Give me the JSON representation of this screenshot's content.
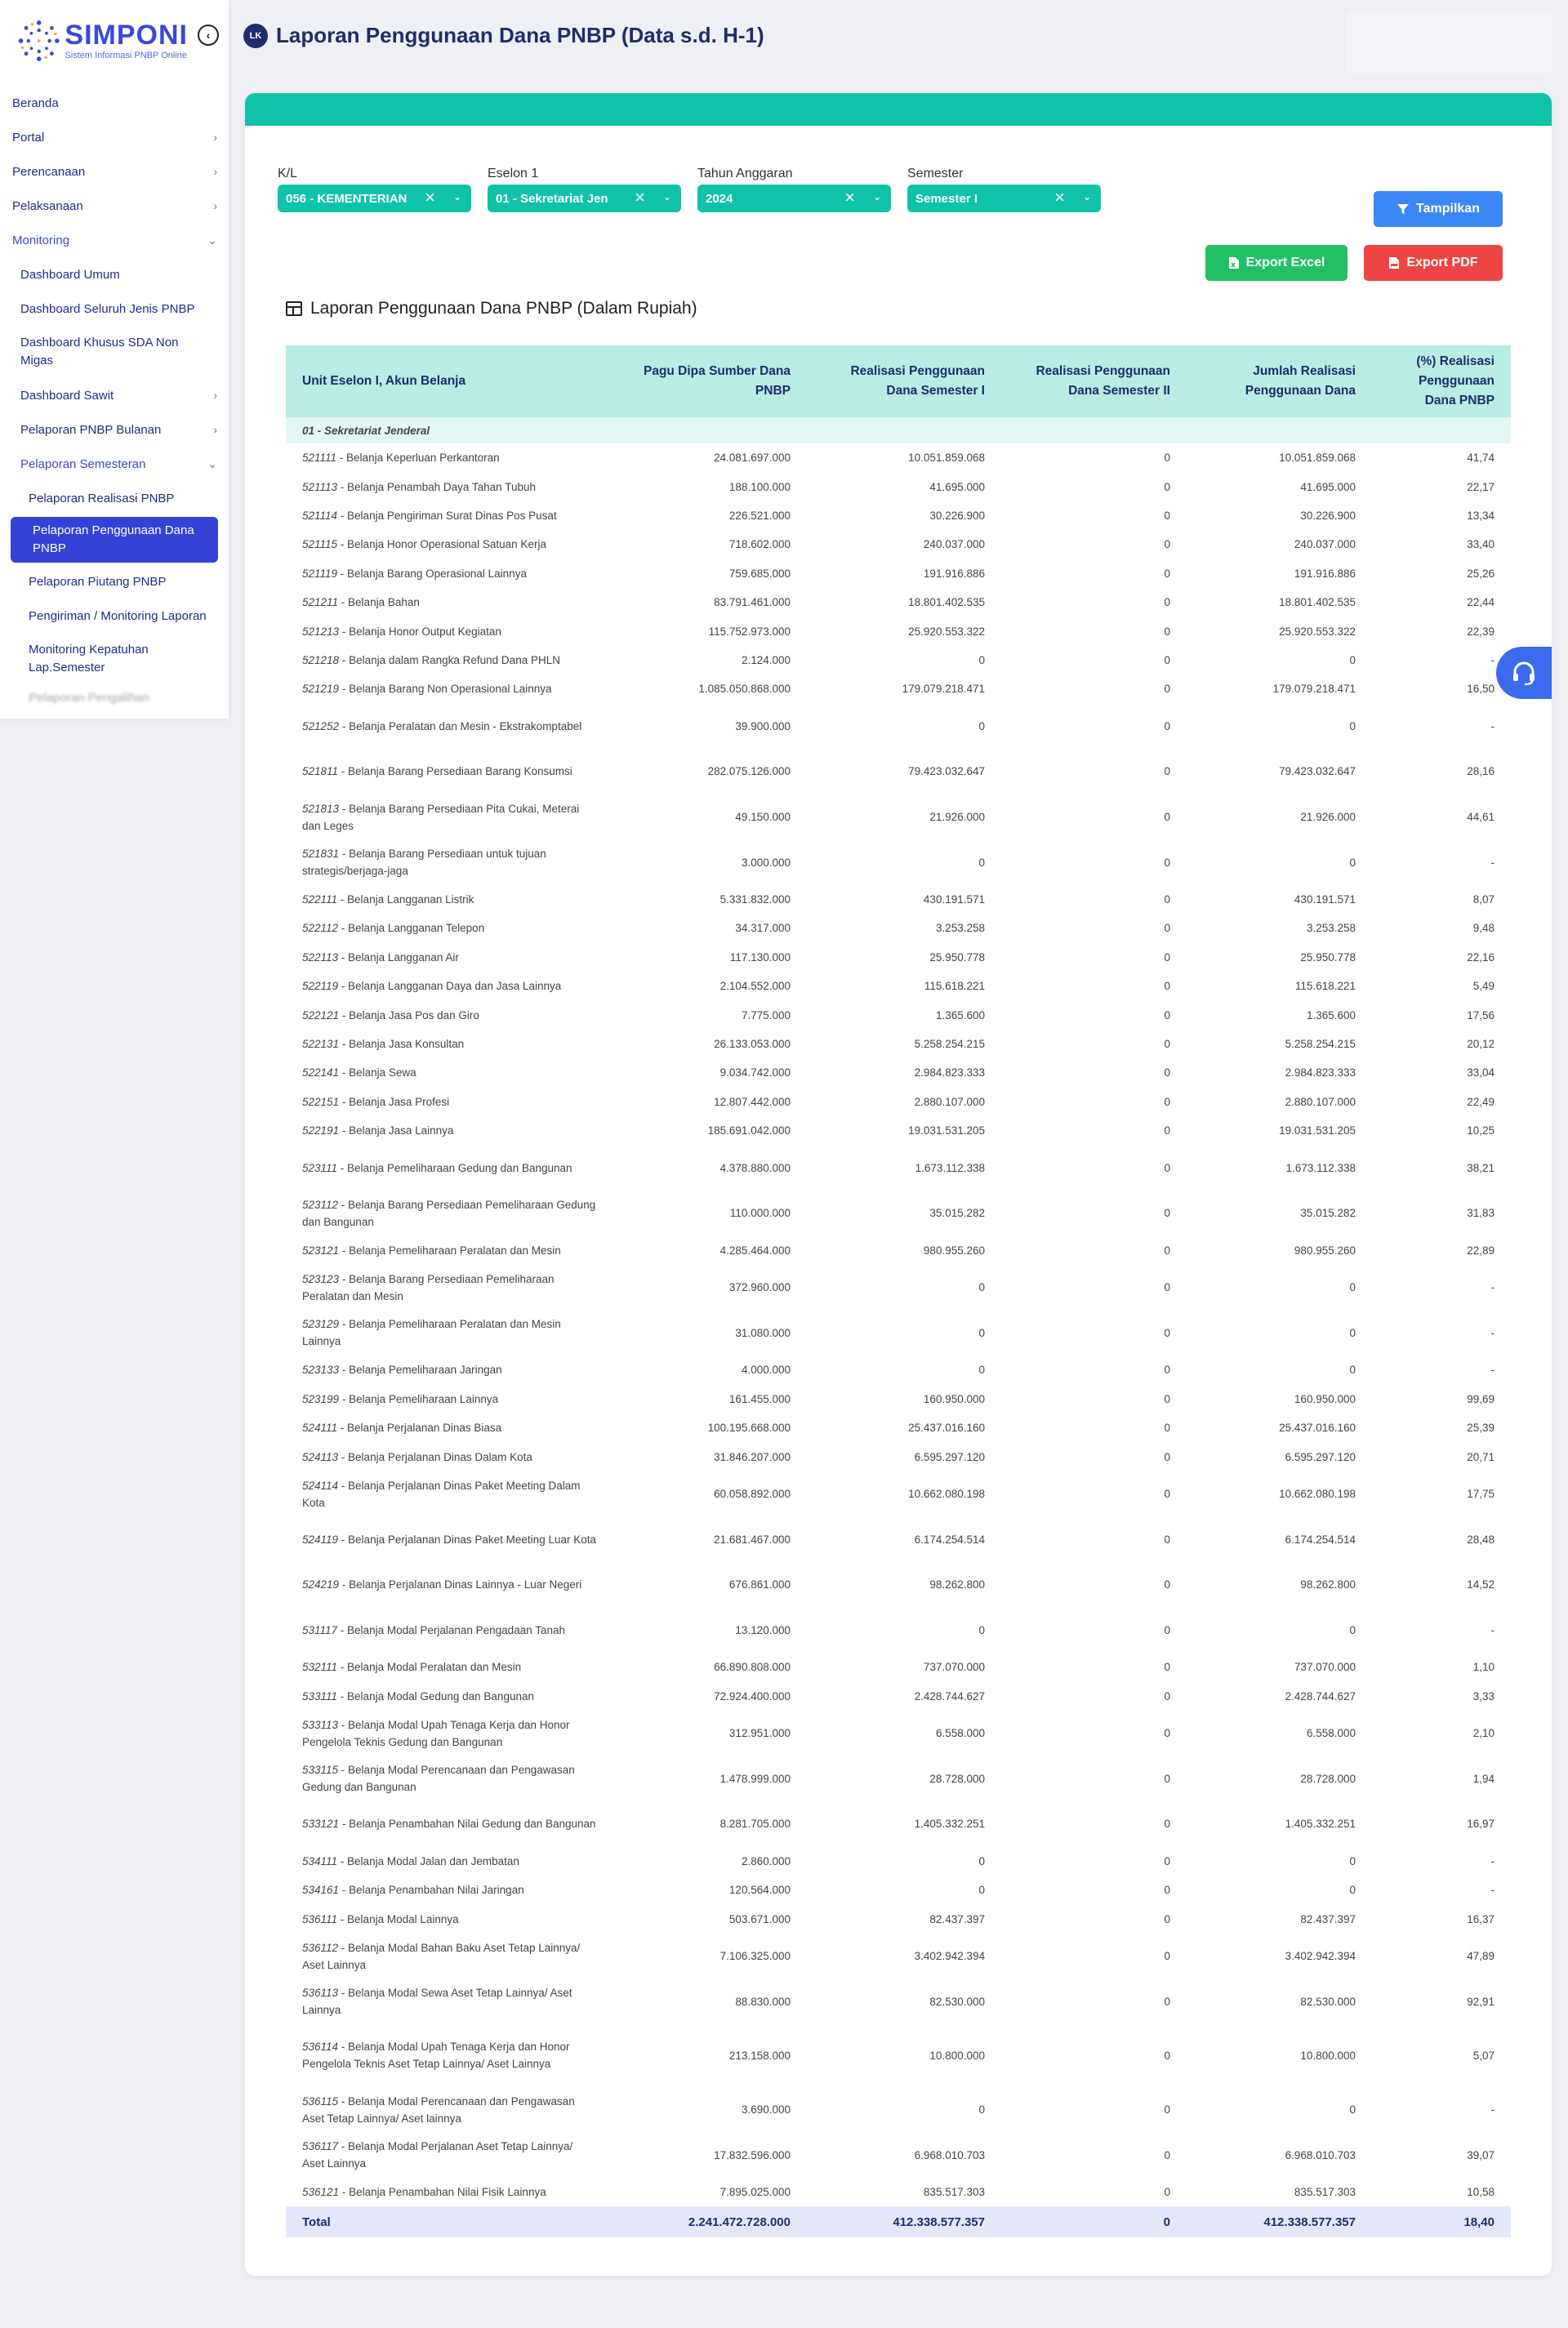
{
  "app": {
    "name": "SIMPONI",
    "subtitle": "Sistem Informasi PNBP Online"
  },
  "sidebar": {
    "items": [
      {
        "label": "Beranda"
      },
      {
        "label": "Portal",
        "chevron": "right"
      },
      {
        "label": "Perencanaan",
        "chevron": "right"
      },
      {
        "label": "Pelaksanaan",
        "chevron": "right"
      },
      {
        "label": "Monitoring",
        "chevron": "down"
      },
      {
        "label": "Dashboard Umum"
      },
      {
        "label": "Dashboard Seluruh Jenis PNBP"
      },
      {
        "label": "Dashboard Khusus SDA Non Migas"
      },
      {
        "label": "Dashboard Sawit",
        "chevron": "right"
      },
      {
        "label": "Pelaporan PNBP Bulanan",
        "chevron": "right"
      },
      {
        "label": "Pelaporan Semesteran",
        "chevron": "down"
      },
      {
        "label": "Pelaporan Realisasi PNBP"
      },
      {
        "label": "Pelaporan Penggunaan Dana PNBP"
      },
      {
        "label": "Pelaporan Piutang PNBP"
      },
      {
        "label": "Pengiriman / Monitoring Laporan"
      },
      {
        "label": "Monitoring Kepatuhan Lap.Semester"
      },
      {
        "label": "Pelaporan Pengalihan"
      }
    ]
  },
  "header": {
    "title": "Laporan Penggunaan Dana PNBP (Data s.d. H-1)",
    "icon_text": "LK"
  },
  "filters": {
    "kl": {
      "label": "K/L",
      "value": "056 - KEMENTERIAN"
    },
    "eselon": {
      "label": "Eselon 1",
      "value": "01 - Sekretariat Jen"
    },
    "tahun": {
      "label": "Tahun Anggaran",
      "value": "2024"
    },
    "semester": {
      "label": "Semester",
      "value": "Semester I"
    }
  },
  "buttons": {
    "show": "Tampilkan",
    "excel": "Export Excel",
    "pdf": "Export PDF"
  },
  "section_title": "Laporan Penggunaan Dana PNBP (Dalam Rupiah)",
  "table": {
    "headers": [
      "Unit Eselon I, Akun Belanja",
      "Pagu Dipa Sumber Dana PNBP",
      "Realisasi Penggunaan Dana Semester I",
      "Realisasi Penggunaan Dana Semester II",
      "Jumlah Realisasi Penggunaan Dana",
      "(%) Realisasi Penggunaan Dana PNBP"
    ],
    "group": "01 - Sekretariat Jenderal",
    "rows": [
      {
        "code": "521111",
        "name": "Belanja Keperluan Perkantoran",
        "pagu": "24.081.697.000",
        "s1": "10.051.859.068",
        "s2": "0",
        "jumlah": "10.051.859.068",
        "pct": "41,74",
        "lines": 1
      },
      {
        "code": "521113",
        "name": "Belanja Penambah Daya Tahan Tubuh",
        "pagu": "188.100.000",
        "s1": "41.695.000",
        "s2": "0",
        "jumlah": "41.695.000",
        "pct": "22,17",
        "lines": 1
      },
      {
        "code": "521114",
        "name": "Belanja Pengiriman Surat Dinas Pos Pusat",
        "pagu": "226.521.000",
        "s1": "30.226.900",
        "s2": "0",
        "jumlah": "30.226.900",
        "pct": "13,34",
        "lines": 1
      },
      {
        "code": "521115",
        "name": "Belanja Honor Operasional Satuan Kerja",
        "pagu": "718.602.000",
        "s1": "240.037.000",
        "s2": "0",
        "jumlah": "240.037.000",
        "pct": "33,40",
        "lines": 1
      },
      {
        "code": "521119",
        "name": "Belanja Barang Operasional Lainnya",
        "pagu": "759.685.000",
        "s1": "191.916.886",
        "s2": "0",
        "jumlah": "191.916.886",
        "pct": "25,26",
        "lines": 1
      },
      {
        "code": "521211",
        "name": "Belanja Bahan",
        "pagu": "83.791.461.000",
        "s1": "18.801.402.535",
        "s2": "0",
        "jumlah": "18.801.402.535",
        "pct": "22,44",
        "lines": 1
      },
      {
        "code": "521213",
        "name": "Belanja Honor Output Kegiatan",
        "pagu": "115.752.973.000",
        "s1": "25.920.553.322",
        "s2": "0",
        "jumlah": "25.920.553.322",
        "pct": "22,39",
        "lines": 1
      },
      {
        "code": "521218",
        "name": "Belanja dalam Rangka Refund Dana PHLN",
        "pagu": "2.124.000",
        "s1": "0",
        "s2": "0",
        "jumlah": "0",
        "pct": "-",
        "lines": 1
      },
      {
        "code": "521219",
        "name": "Belanja Barang Non Operasional Lainnya",
        "pagu": "1.085.050.868.000",
        "s1": "179.079.218.471",
        "s2": "0",
        "jumlah": "179.079.218.471",
        "pct": "16,50",
        "lines": 1
      },
      {
        "code": "521252",
        "name": "Belanja Peralatan dan Mesin - Ekstrakomptabel",
        "pagu": "39.900.000",
        "s1": "0",
        "s2": "0",
        "jumlah": "0",
        "pct": "-",
        "lines": 2
      },
      {
        "code": "521811",
        "name": "Belanja Barang Persediaan Barang Konsumsi",
        "pagu": "282.075.126.000",
        "s1": "79.423.032.647",
        "s2": "0",
        "jumlah": "79.423.032.647",
        "pct": "28,16",
        "lines": 2
      },
      {
        "code": "521813",
        "name": "Belanja Barang Persediaan Pita Cukai, Meterai dan Leges",
        "pagu": "49.150.000",
        "s1": "21.926.000",
        "s2": "0",
        "jumlah": "21.926.000",
        "pct": "44,61",
        "lines": 2
      },
      {
        "code": "521831",
        "name": "Belanja Barang Persediaan untuk tujuan strategis/berjaga-jaga",
        "pagu": "3.000.000",
        "s1": "0",
        "s2": "0",
        "jumlah": "0",
        "pct": "-",
        "lines": 2
      },
      {
        "code": "522111",
        "name": "Belanja Langganan Listrik",
        "pagu": "5.331.832.000",
        "s1": "430.191.571",
        "s2": "0",
        "jumlah": "430.191.571",
        "pct": "8,07",
        "lines": 1
      },
      {
        "code": "522112",
        "name": "Belanja Langganan Telepon",
        "pagu": "34.317.000",
        "s1": "3.253.258",
        "s2": "0",
        "jumlah": "3.253.258",
        "pct": "9,48",
        "lines": 1
      },
      {
        "code": "522113",
        "name": "Belanja Langganan Air",
        "pagu": "117.130.000",
        "s1": "25.950.778",
        "s2": "0",
        "jumlah": "25.950.778",
        "pct": "22,16",
        "lines": 1
      },
      {
        "code": "522119",
        "name": "Belanja Langganan Daya dan Jasa Lainnya",
        "pagu": "2.104.552.000",
        "s1": "115.618.221",
        "s2": "0",
        "jumlah": "115.618.221",
        "pct": "5,49",
        "lines": 1
      },
      {
        "code": "522121",
        "name": "Belanja Jasa Pos dan Giro",
        "pagu": "7.775.000",
        "s1": "1.365.600",
        "s2": "0",
        "jumlah": "1.365.600",
        "pct": "17,56",
        "lines": 1
      },
      {
        "code": "522131",
        "name": "Belanja Jasa Konsultan",
        "pagu": "26.133.053.000",
        "s1": "5.258.254.215",
        "s2": "0",
        "jumlah": "5.258.254.215",
        "pct": "20,12",
        "lines": 1
      },
      {
        "code": "522141",
        "name": "Belanja Sewa",
        "pagu": "9.034.742.000",
        "s1": "2.984.823.333",
        "s2": "0",
        "jumlah": "2.984.823.333",
        "pct": "33,04",
        "lines": 1
      },
      {
        "code": "522151",
        "name": "Belanja Jasa Profesi",
        "pagu": "12.807.442.000",
        "s1": "2.880.107.000",
        "s2": "0",
        "jumlah": "2.880.107.000",
        "pct": "22,49",
        "lines": 1
      },
      {
        "code": "522191",
        "name": "Belanja Jasa Lainnya",
        "pagu": "185.691.042.000",
        "s1": "19.031.531.205",
        "s2": "0",
        "jumlah": "19.031.531.205",
        "pct": "10,25",
        "lines": 1
      },
      {
        "code": "523111",
        "name": "Belanja Pemeliharaan Gedung dan Bangunan",
        "pagu": "4.378.880.000",
        "s1": "1.673.112.338",
        "s2": "0",
        "jumlah": "1.673.112.338",
        "pct": "38,21",
        "lines": 2
      },
      {
        "code": "523112",
        "name": "Belanja Barang Persediaan Pemeliharaan Gedung dan Bangunan",
        "pagu": "110.000.000",
        "s1": "35.015.282",
        "s2": "0",
        "jumlah": "35.015.282",
        "pct": "31,83",
        "lines": 2
      },
      {
        "code": "523121",
        "name": "Belanja Pemeliharaan Peralatan dan Mesin",
        "pagu": "4.285.464.000",
        "s1": "980.955.260",
        "s2": "0",
        "jumlah": "980.955.260",
        "pct": "22,89",
        "lines": 1
      },
      {
        "code": "523123",
        "name": "Belanja Barang Persediaan Pemeliharaan Peralatan dan Mesin",
        "pagu": "372.960.000",
        "s1": "0",
        "s2": "0",
        "jumlah": "0",
        "pct": "-",
        "lines": 2
      },
      {
        "code": "523129",
        "name": "Belanja Pemeliharaan Peralatan dan Mesin Lainnya",
        "pagu": "31.080.000",
        "s1": "0",
        "s2": "0",
        "jumlah": "0",
        "pct": "-",
        "lines": 2
      },
      {
        "code": "523133",
        "name": "Belanja Pemeliharaan Jaringan",
        "pagu": "4.000.000",
        "s1": "0",
        "s2": "0",
        "jumlah": "0",
        "pct": "-",
        "lines": 1
      },
      {
        "code": "523199",
        "name": "Belanja Pemeliharaan Lainnya",
        "pagu": "161.455.000",
        "s1": "160.950.000",
        "s2": "0",
        "jumlah": "160.950.000",
        "pct": "99,69",
        "lines": 1
      },
      {
        "code": "524111",
        "name": "Belanja Perjalanan Dinas Biasa",
        "pagu": "100.195.668.000",
        "s1": "25.437.016.160",
        "s2": "0",
        "jumlah": "25.437.016.160",
        "pct": "25,39",
        "lines": 1
      },
      {
        "code": "524113",
        "name": "Belanja Perjalanan Dinas Dalam Kota",
        "pagu": "31.846.207.000",
        "s1": "6.595.297.120",
        "s2": "0",
        "jumlah": "6.595.297.120",
        "pct": "20,71",
        "lines": 1
      },
      {
        "code": "524114",
        "name": "Belanja Perjalanan Dinas Paket Meeting Dalam Kota",
        "pagu": "60.058.892.000",
        "s1": "10.662.080.198",
        "s2": "0",
        "jumlah": "10.662.080.198",
        "pct": "17,75",
        "lines": 2
      },
      {
        "code": "524119",
        "name": "Belanja Perjalanan Dinas Paket Meeting Luar Kota",
        "pagu": "21.681.467.000",
        "s1": "6.174.254.514",
        "s2": "0",
        "jumlah": "6.174.254.514",
        "pct": "28,48",
        "lines": 2
      },
      {
        "code": "524219",
        "name": "Belanja Perjalanan Dinas Lainnya - Luar Negeri",
        "pagu": "676.861.000",
        "s1": "98.262.800",
        "s2": "0",
        "jumlah": "98.262.800",
        "pct": "14,52",
        "lines": 2
      },
      {
        "code": "531117",
        "name": "Belanja Modal Perjalanan Pengadaan Tanah",
        "pagu": "13.120.000",
        "s1": "0",
        "s2": "0",
        "jumlah": "0",
        "pct": "-",
        "lines": 2
      },
      {
        "code": "532111",
        "name": "Belanja Modal Peralatan dan Mesin",
        "pagu": "66.890.808.000",
        "s1": "737.070.000",
        "s2": "0",
        "jumlah": "737.070.000",
        "pct": "1,10",
        "lines": 1
      },
      {
        "code": "533111",
        "name": "Belanja Modal Gedung dan Bangunan",
        "pagu": "72.924.400.000",
        "s1": "2.428.744.627",
        "s2": "0",
        "jumlah": "2.428.744.627",
        "pct": "3,33",
        "lines": 1
      },
      {
        "code": "533113",
        "name": "Belanja Modal Upah Tenaga Kerja dan Honor Pengelola Teknis Gedung dan Bangunan",
        "pagu": "312.951.000",
        "s1": "6.558.000",
        "s2": "0",
        "jumlah": "6.558.000",
        "pct": "2,10",
        "lines": 2
      },
      {
        "code": "533115",
        "name": "Belanja Modal Perencanaan dan Pengawasan Gedung dan Bangunan",
        "pagu": "1.478.999.000",
        "s1": "28.728.000",
        "s2": "0",
        "jumlah": "28.728.000",
        "pct": "1,94",
        "lines": 2
      },
      {
        "code": "533121",
        "name": "Belanja Penambahan Nilai Gedung dan Bangunan",
        "pagu": "8.281.705.000",
        "s1": "1.405.332.251",
        "s2": "0",
        "jumlah": "1.405.332.251",
        "pct": "16,97",
        "lines": 2
      },
      {
        "code": "534111",
        "name": "Belanja Modal Jalan dan Jembatan",
        "pagu": "2.860.000",
        "s1": "0",
        "s2": "0",
        "jumlah": "0",
        "pct": "-",
        "lines": 1
      },
      {
        "code": "534161",
        "name": "Belanja Penambahan Nilai Jaringan",
        "pagu": "120.564.000",
        "s1": "0",
        "s2": "0",
        "jumlah": "0",
        "pct": "-",
        "lines": 1
      },
      {
        "code": "536111",
        "name": "Belanja Modal Lainnya",
        "pagu": "503.671.000",
        "s1": "82.437.397",
        "s2": "0",
        "jumlah": "82.437.397",
        "pct": "16,37",
        "lines": 1
      },
      {
        "code": "536112",
        "name": "Belanja Modal Bahan Baku Aset Tetap Lainnya/ Aset Lainnya",
        "pagu": "7.106.325.000",
        "s1": "3.402.942.394",
        "s2": "0",
        "jumlah": "3.402.942.394",
        "pct": "47,89",
        "lines": 2
      },
      {
        "code": "536113",
        "name": "Belanja Modal Sewa Aset Tetap Lainnya/ Aset Lainnya",
        "pagu": "88.830.000",
        "s1": "82.530.000",
        "s2": "0",
        "jumlah": "82.530.000",
        "pct": "92,91",
        "lines": 2
      },
      {
        "code": "536114",
        "name": "Belanja Modal Upah Tenaga Kerja dan Honor Pengelola Teknis Aset Tetap Lainnya/ Aset Lainnya",
        "pagu": "213.158.000",
        "s1": "10.800.000",
        "s2": "0",
        "jumlah": "10.800.000",
        "pct": "5,07",
        "lines": 3
      },
      {
        "code": "536115",
        "name": "Belanja Modal Perencanaan dan Pengawasan Aset Tetap Lainnya/ Aset lainnya",
        "pagu": "3.690.000",
        "s1": "0",
        "s2": "0",
        "jumlah": "0",
        "pct": "-",
        "lines": 2
      },
      {
        "code": "536117",
        "name": "Belanja Modal Perjalanan Aset Tetap Lainnya/ Aset Lainnya",
        "pagu": "17.832.596.000",
        "s1": "6.968.010.703",
        "s2": "0",
        "jumlah": "6.968.010.703",
        "pct": "39,07",
        "lines": 2
      },
      {
        "code": "536121",
        "name": "Belanja Penambahan Nilai Fisik Lainnya",
        "pagu": "7.895.025.000",
        "s1": "835.517.303",
        "s2": "0",
        "jumlah": "835.517.303",
        "pct": "10,58",
        "lines": 1
      }
    ],
    "total": {
      "label": "Total",
      "pagu": "2.241.472.728.000",
      "s1": "412.338.577.357",
      "s2": "0",
      "jumlah": "412.338.577.357",
      "pct": "18,40"
    }
  },
  "colors": {
    "brand": "#3a49d8",
    "teal": "#10c3a8",
    "header_bg": "#b8ece4",
    "nav_text": "#1f2d8a",
    "show_button": "#3b87f5",
    "excel_button": "#22c064",
    "pdf_button": "#ef4444"
  },
  "icons": {
    "header": "report-icon",
    "collapse": "chevron-left-icon",
    "filter": "filter-icon",
    "excel": "file-excel-icon",
    "pdf": "file-pdf-icon",
    "table": "table-icon",
    "help": "headset-icon"
  }
}
